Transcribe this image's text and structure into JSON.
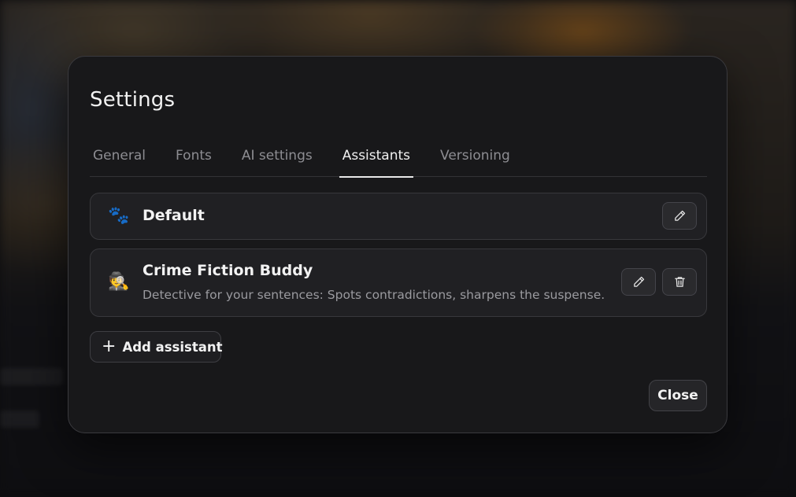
{
  "dialog": {
    "title": "Settings"
  },
  "tabs": [
    {
      "label": "General",
      "active": false
    },
    {
      "label": "Fonts",
      "active": false
    },
    {
      "label": "AI settings",
      "active": false
    },
    {
      "label": "Assistants",
      "active": true
    },
    {
      "label": "Versioning",
      "active": false
    }
  ],
  "assistants": [
    {
      "avatar": "🐾",
      "name": "Default",
      "description": "",
      "actions": [
        "edit-icon"
      ]
    },
    {
      "avatar": "🕵️",
      "name": "Crime Fiction Buddy",
      "description": "Detective for your sentences: Spots contradictions, sharpens the suspense.",
      "actions": [
        "edit-icon",
        "trash-icon"
      ]
    }
  ],
  "buttons": {
    "add_assistant_icon": "+",
    "add_assistant": "Add assistant",
    "close": "Close"
  },
  "colors": {
    "modal_background": "#18181a",
    "card_background": "#202023",
    "text_primary": "#f2f2f2",
    "text_muted": "#8d8d92"
  }
}
